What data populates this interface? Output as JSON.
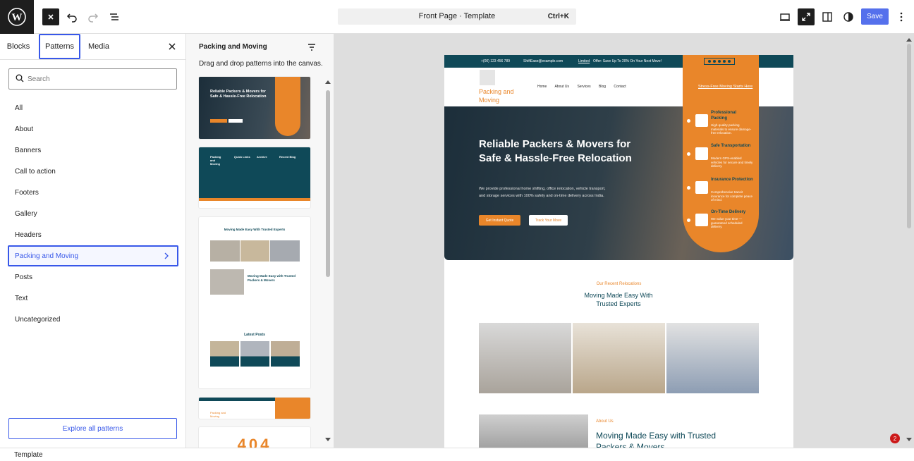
{
  "toolbar": {
    "document_title": "Front Page · Template",
    "shortcut": "Ctrl+K",
    "save_label": "Save"
  },
  "inserter": {
    "tabs": [
      {
        "label": "Blocks"
      },
      {
        "label": "Patterns",
        "active": true
      },
      {
        "label": "Media"
      }
    ],
    "search_placeholder": "Search",
    "categories": [
      {
        "label": "All"
      },
      {
        "label": "About"
      },
      {
        "label": "Banners"
      },
      {
        "label": "Call to action"
      },
      {
        "label": "Footers"
      },
      {
        "label": "Gallery"
      },
      {
        "label": "Headers"
      },
      {
        "label": "Packing and Moving",
        "selected": true
      },
      {
        "label": "Posts"
      },
      {
        "label": "Text"
      },
      {
        "label": "Uncategorized"
      }
    ],
    "explore_label": "Explore all patterns"
  },
  "patterns_panel": {
    "title": "Packing and Moving",
    "description": "Drag and drop patterns into the canvas.",
    "card1_title": "Reliable Packers & Movers for Safe & Hassle-Free Relocation",
    "card2_cols": [
      "Packing and Moving",
      "Quick Links",
      "Archive",
      "Recent Blog"
    ],
    "card3_title": "Moving Made Easy With Trusted Experts",
    "card3_about": "Moving Made Easy with Trusted Packers & Movers",
    "card3_posts": "Latest Posts",
    "card4_logo": "Packing and Moving",
    "card5_text": "404"
  },
  "canvas": {
    "topstrip": {
      "phone": "+(00) 123 456 789",
      "email": "ShiftEase@example.com",
      "offer_label": "Limited",
      "offer_text": "Offer: Save Up To 20% On Your Next Move!"
    },
    "site_title": "Packing and Moving",
    "nav": [
      "Home",
      "About Us",
      "Services",
      "Blog",
      "Contact"
    ],
    "cta_link": "Stress-Free Moving Starts Here",
    "hero_title": "Reliable Packers & Movers for Safe & Hassle-Free Relocation",
    "hero_desc": "We provide professional home shifting, office relocation, vehicle transport, and storage services with 100% safety and on-time delivery across India.",
    "btn_quote": "Get Instant Quote",
    "btn_track": "Track Your Move",
    "features": [
      {
        "title": "Professional Packing",
        "desc": "High-quality packing materials to ensure damage-free relocation."
      },
      {
        "title": "Safe Transportation",
        "desc": "Modern GPS-enabled vehicles for secure and timely delivery."
      },
      {
        "title": "Insurance Protection",
        "desc": "Comprehensive transit insurance for complete peace of mind."
      },
      {
        "title": "On-Time Delivery",
        "desc": "We value your time — guaranteed scheduled delivery."
      }
    ],
    "recent_label": "Our Recent Relocations",
    "recent_title": "Moving Made Easy With Trusted Experts",
    "about_label": "About Us",
    "about_title": "Moving Made Easy with Trusted Packers & Movers"
  },
  "status": {
    "breadcrumb": "Template",
    "notice_count": "2"
  },
  "colors": {
    "accent": "#3858e9",
    "brand_teal": "#0f4958",
    "brand_orange": "#e9862a"
  }
}
